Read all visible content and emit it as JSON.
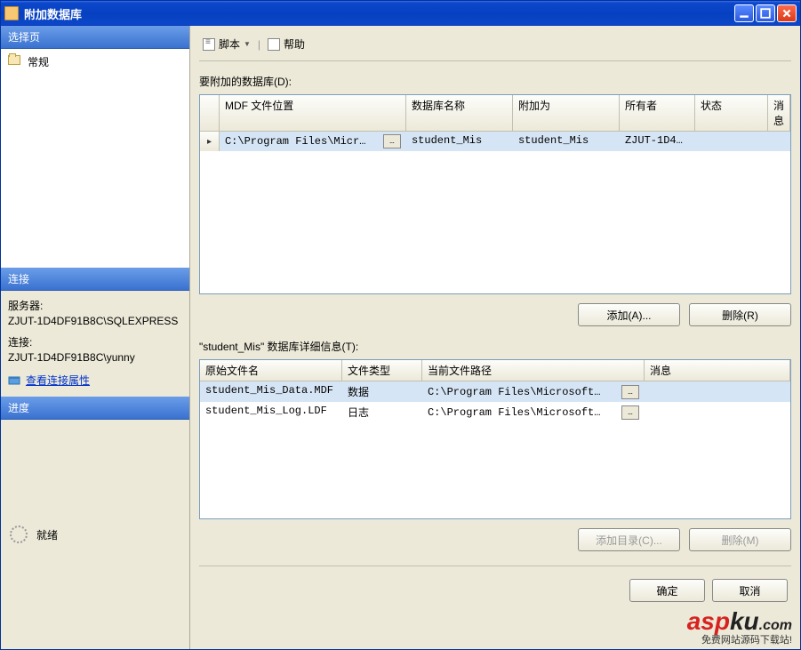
{
  "window": {
    "title": "附加数据库"
  },
  "sidebar": {
    "select_page": "选择页",
    "general": "常规",
    "connection_header": "连接",
    "server_label": "服务器:",
    "server_value": "ZJUT-1D4DF91B8C\\SQLEXPRESS",
    "conn_label": "连接:",
    "conn_value": "ZJUT-1D4DF91B8C\\yunny",
    "view_props": "查看连接属性",
    "progress_header": "进度",
    "progress_value": "就绪"
  },
  "toolbar": {
    "script": "脚本",
    "help": "帮助"
  },
  "main": {
    "attach_label": "要附加的数据库(D):",
    "grid1_headers": {
      "mdf": "MDF 文件位置",
      "dbname": "数据库名称",
      "attas": "附加为",
      "owner": "所有者",
      "status": "状态",
      "msg": "消息"
    },
    "rows": [
      {
        "mdf": "C:\\Program Files\\Micr…",
        "dbname": "student_Mis",
        "attas": "student_Mis",
        "owner": "ZJUT-1D4…",
        "status": "",
        "msg": ""
      }
    ],
    "btn_add": "添加(A)...",
    "btn_remove": "删除(R)",
    "detail_label_prefix": "\"",
    "detail_label_db": "student_Mis",
    "detail_label_suffix": "\" 数据库详细信息(T):",
    "grid2_headers": {
      "orig": "原始文件名",
      "type": "文件类型",
      "path": "当前文件路径",
      "msg": "消息"
    },
    "details": [
      {
        "orig": "student_Mis_Data.MDF",
        "type": "数据",
        "path": "C:\\Program Files\\Microsoft…"
      },
      {
        "orig": "student_Mis_Log.LDF",
        "type": "日志",
        "path": "C:\\Program Files\\Microsoft…"
      }
    ],
    "btn_add_dir": "添加目录(C)...",
    "btn_remove2": "删除(M)",
    "btn_ok": "确定",
    "btn_cancel": "取消"
  },
  "watermark": {
    "asp": "asp",
    "ku": "ku",
    "com": ".com",
    "sub": "免费网站源码下载站!"
  }
}
